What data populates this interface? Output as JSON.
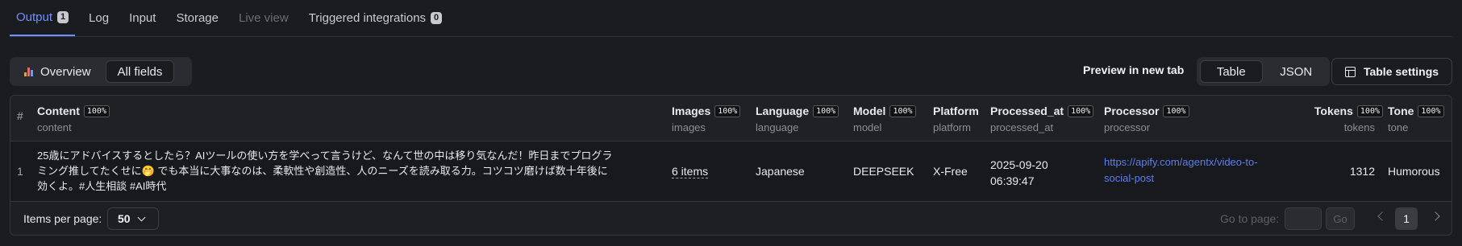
{
  "tabs": [
    {
      "label": "Output",
      "badge": "1"
    },
    {
      "label": "Log"
    },
    {
      "label": "Input"
    },
    {
      "label": "Storage"
    },
    {
      "label": "Live view"
    },
    {
      "label": "Triggered integrations",
      "badge": "0"
    }
  ],
  "toolbar": {
    "overview_label": "Overview",
    "all_fields_label": "All fields",
    "preview_label": "Preview in new tab",
    "table_label": "Table",
    "json_label": "JSON",
    "settings_label": "Table settings"
  },
  "table": {
    "index_header": "#",
    "columns": [
      {
        "title": "Content",
        "pct": "100%",
        "sub": "content"
      },
      {
        "title": "Images",
        "pct": "100%",
        "sub": "images"
      },
      {
        "title": "Language",
        "pct": "100%",
        "sub": "language"
      },
      {
        "title": "Model",
        "pct": "100%",
        "sub": "model"
      },
      {
        "title": "Platform",
        "sub": "platform"
      },
      {
        "title": "Processed_at",
        "pct": "100%",
        "sub": "processed_at"
      },
      {
        "title": "Processor",
        "pct": "100%",
        "sub": "processor"
      },
      {
        "title": "Tokens",
        "pct": "100%",
        "sub": "tokens"
      },
      {
        "title": "Tone",
        "pct": "100%",
        "sub": "tone"
      }
    ],
    "rows": [
      {
        "index": "1",
        "content_l1": "25歳にアドバイスするとしたら？AIツールの使い方を学べって言うけど、なんて世の中は移り気なんだ！昨日までプログラ",
        "content_l2": "ミング推してたくせに🤭 でも本当に大事なのは、柔軟性や創造性、人のニーズを読み取る力。コツコツ磨けば数十年後に",
        "content_l3": "効くよ。#人生相談 #AI時代",
        "images": "6 items",
        "language": "Japanese",
        "model": "DEEPSEEK",
        "platform": "X-Free",
        "processed_date": "2025-09-20",
        "processed_time": "06:39:47",
        "processor_l1": "https://apify.com/agentx/video-to-",
        "processor_l2": "social-post",
        "tokens": "1312",
        "tone": "Humorous"
      }
    ]
  },
  "footer": {
    "items_per_page_label": "Items per page:",
    "items_per_page": "50",
    "goto_label": "Go to page:",
    "go_label": "Go",
    "current_page": "1"
  },
  "colors": {
    "accent": "#6f8fff",
    "link": "#5b7ef0",
    "background": "#1b1c20"
  }
}
